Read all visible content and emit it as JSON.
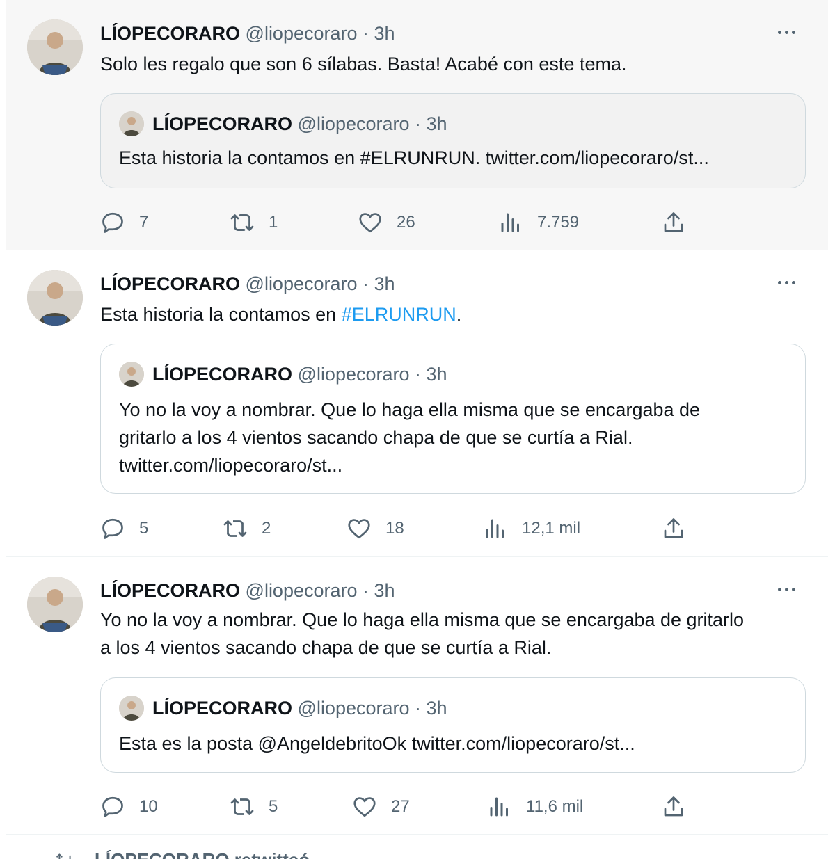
{
  "tweets": [
    {
      "name": "LÍOPECORARO",
      "handle": "@liopecoraro",
      "time": "· 3h",
      "text": "Solo les regalo que son 6 sílabas. Basta! Acabé con este tema.",
      "quote": {
        "name": "LÍOPECORARO",
        "handle": "@liopecoraro",
        "time": "· 3h",
        "text": "Esta historia la contamos en #ELRUNRUN. twitter.com/liopecoraro/st..."
      },
      "stats": {
        "replies": "7",
        "retweets": "1",
        "likes": "26",
        "views": "7.759"
      }
    },
    {
      "name": "LÍOPECORARO",
      "handle": "@liopecoraro",
      "time": "· 3h",
      "text_pre": "Esta historia la contamos en ",
      "hashtag": "#ELRUNRUN",
      "text_post": ".",
      "quote": {
        "name": "LÍOPECORARO",
        "handle": "@liopecoraro",
        "time": "· 3h",
        "text_line1": "Yo no la voy a nombrar. Que lo haga ella misma que se encargaba de",
        "text_line2": "gritarlo a los 4 vientos sacando chapa de que se curtía a Rial.",
        "text_line3": "twitter.com/liopecoraro/st..."
      },
      "stats": {
        "replies": "5",
        "retweets": "2",
        "likes": "18",
        "views": "12,1 mil"
      }
    },
    {
      "name": "LÍOPECORARO",
      "handle": "@liopecoraro",
      "time": "· 3h",
      "text_line1": "Yo no la voy a nombrar. Que lo haga ella misma que se encargaba de gritarlo",
      "text_line2": "a los 4 vientos sacando chapa de que se curtía a Rial.",
      "quote": {
        "name": "LÍOPECORARO",
        "handle": "@liopecoraro",
        "time": "· 3h",
        "text": "Esta es la posta @AngeldebritoOk twitter.com/liopecoraro/st..."
      },
      "stats": {
        "replies": "10",
        "retweets": "5",
        "likes": "27",
        "views": "11,6 mil"
      }
    }
  ],
  "partial_next": {
    "text": "LÍOPECORARO retwitteó"
  },
  "colors": {
    "link": "#1d9bf0",
    "secondary": "#536471",
    "border": "#cfd9de",
    "hover_bg": "#f7f7f7"
  },
  "icons": [
    "reply-icon",
    "retweet-icon",
    "like-icon",
    "views-icon",
    "share-icon",
    "more-icon"
  ]
}
